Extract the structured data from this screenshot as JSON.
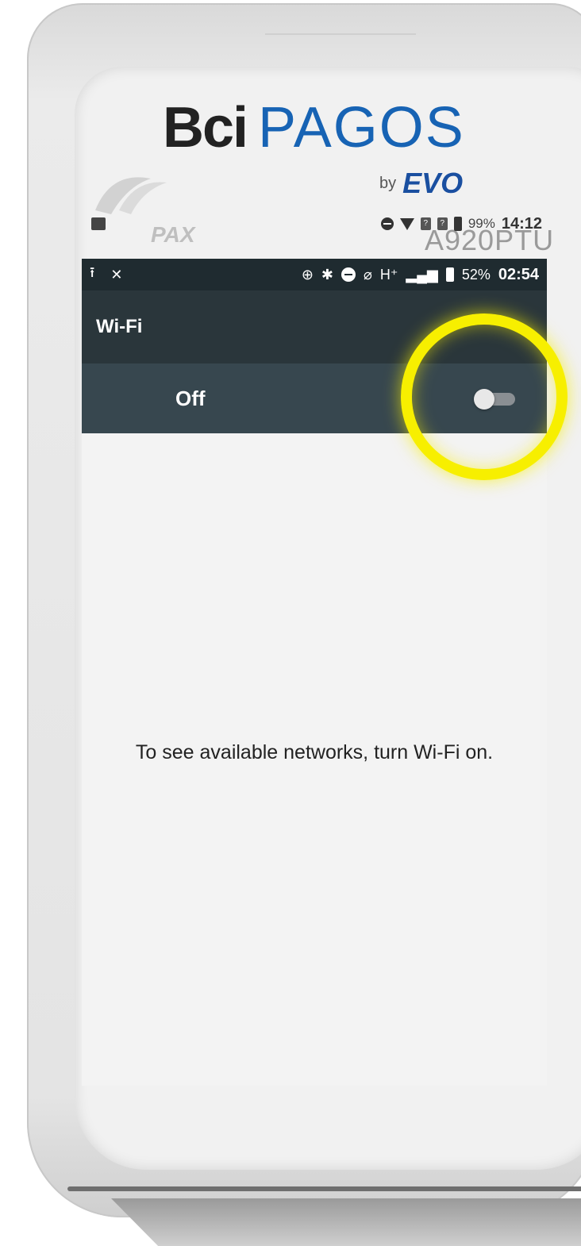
{
  "device": {
    "brand_bci": "Bci",
    "brand_pagos": "PAGOS",
    "by_text": "by",
    "evo_text": "EVO",
    "pax_text": "PAX",
    "model_text": "A920PTU"
  },
  "outer_status": {
    "battery_percent": "99%",
    "time": "14:12"
  },
  "status_bar": {
    "battery_percent": "52%",
    "time": "02:54",
    "network_label": "H⁺"
  },
  "app_bar": {
    "title": "Wi-Fi"
  },
  "wifi_toggle": {
    "label": "Off",
    "enabled": false
  },
  "main": {
    "message": "To see available networks, turn Wi-Fi on."
  },
  "colors": {
    "status_bar": "#1f2b30",
    "app_bar": "#2a363b",
    "toggle_row": "#37474f",
    "highlight": "#f7ef00",
    "brand_blue": "#1763b4"
  }
}
